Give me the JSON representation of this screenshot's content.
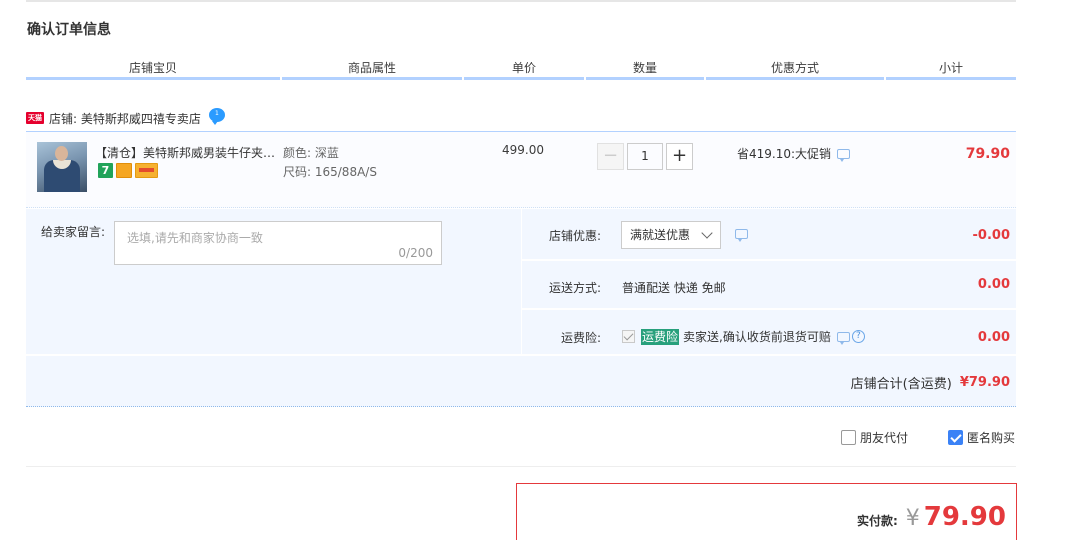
{
  "page": {
    "title": "确认订单信息"
  },
  "headers": [
    "店铺宝贝",
    "商品属性",
    "单价",
    "数量",
    "优惠方式",
    "小计"
  ],
  "shop": {
    "badge": "天猫",
    "label": "店铺: 美特斯邦威四禧专卖店",
    "chat_badge": "1"
  },
  "item": {
    "title": "【清仓】美特斯邦威男装牛仔夹…",
    "service_7": "7",
    "color": "颜色: 深蓝",
    "size": "尺码: 165/88A/S",
    "price": "499.00",
    "quantity": "1",
    "minus": "−",
    "plus": "+",
    "promo": "省419.10:大促销",
    "subtotal": "79.90"
  },
  "options": {
    "note_label": "给卖家留言:",
    "note_placeholder": "选填,请先和商家协商一致",
    "note_count": "0/200",
    "shop_discount_label": "店铺优惠:",
    "shop_discount_value": "满就送优惠",
    "shop_discount_amount": "-0.00",
    "shipping_label": "运送方式:",
    "shipping_value": "普通配送 快递 免邮",
    "shipping_amount": "0.00",
    "insurance_label": "运费险:",
    "insurance_tag": "运费险",
    "insurance_text": "卖家送,确认收货前退货可赔",
    "insurance_help": "?",
    "insurance_amount": "0.00",
    "shop_total_label": "店铺合计(含运费)",
    "shop_total_value": "¥79.90"
  },
  "extras": {
    "friend_pay": "朋友代付",
    "anonymous": "匿名购买",
    "anonymous_checked": true
  },
  "payment": {
    "label": "实付款:",
    "currency": "¥",
    "value": "79.90"
  },
  "colors": {
    "accent_red": "#e4393c",
    "header_line": "#b2d1ff",
    "panel_bg": "#f2f7ff"
  }
}
